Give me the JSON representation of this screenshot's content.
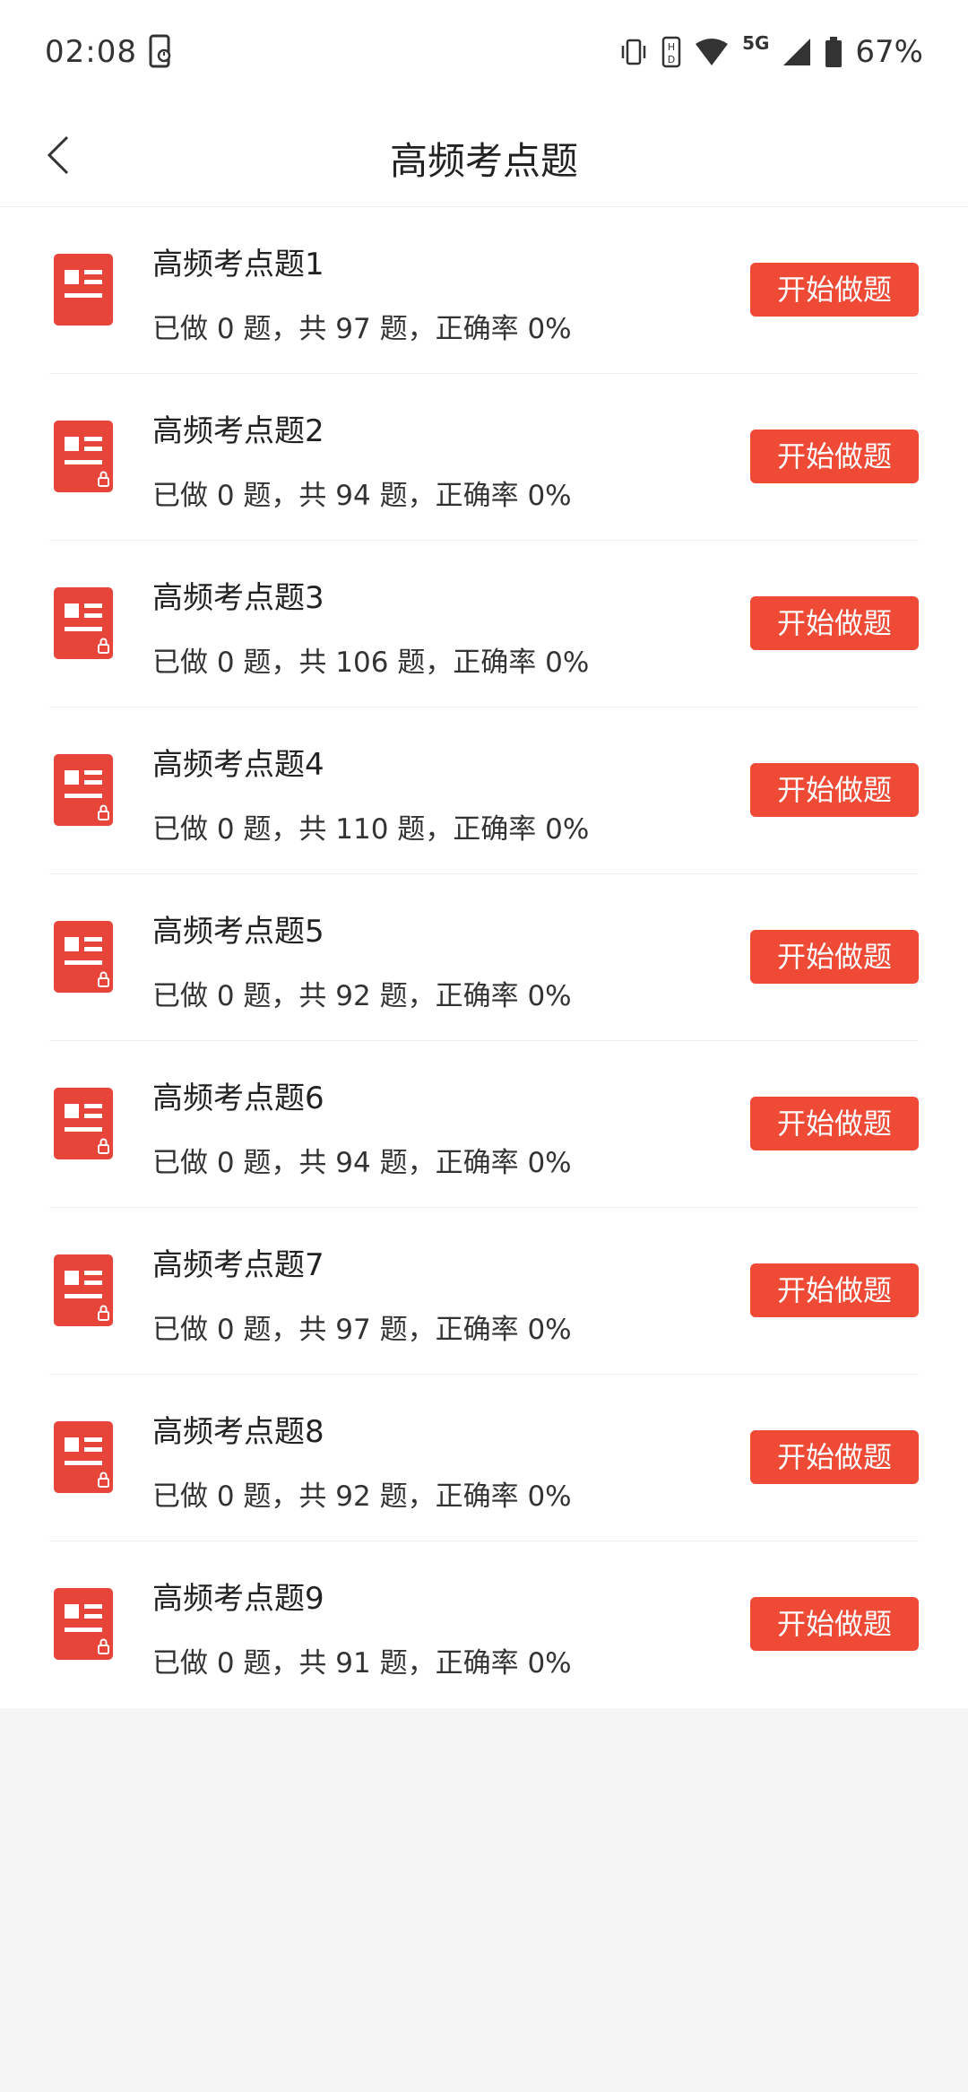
{
  "status_bar": {
    "time": "02:08",
    "network": "5G",
    "battery": "67%"
  },
  "header": {
    "title": "高频考点题",
    "back_icon": "chevron-left-icon"
  },
  "colors": {
    "accent": "#ee4a36",
    "icon_red": "#e8453a"
  },
  "items": [
    {
      "title": "高频考点题1",
      "stats": "已做 0 题，共 97 题，正确率 0%",
      "button": "开始做题",
      "locked": false
    },
    {
      "title": "高频考点题2",
      "stats": "已做 0 题，共 94 题，正确率 0%",
      "button": "开始做题",
      "locked": true
    },
    {
      "title": "高频考点题3",
      "stats": "已做 0 题，共 106 题，正确率 0%",
      "button": "开始做题",
      "locked": true
    },
    {
      "title": "高频考点题4",
      "stats": "已做 0 题，共 110 题，正确率 0%",
      "button": "开始做题",
      "locked": true
    },
    {
      "title": "高频考点题5",
      "stats": "已做 0 题，共 92 题，正确率 0%",
      "button": "开始做题",
      "locked": true
    },
    {
      "title": "高频考点题6",
      "stats": "已做 0 题，共 94 题，正确率 0%",
      "button": "开始做题",
      "locked": true
    },
    {
      "title": "高频考点题7",
      "stats": "已做 0 题，共 97 题，正确率 0%",
      "button": "开始做题",
      "locked": true
    },
    {
      "title": "高频考点题8",
      "stats": "已做 0 题，共 92 题，正确率 0%",
      "button": "开始做题",
      "locked": true
    },
    {
      "title": "高频考点题9",
      "stats": "已做 0 题，共 91 题，正确率 0%",
      "button": "开始做题",
      "locked": true
    }
  ]
}
